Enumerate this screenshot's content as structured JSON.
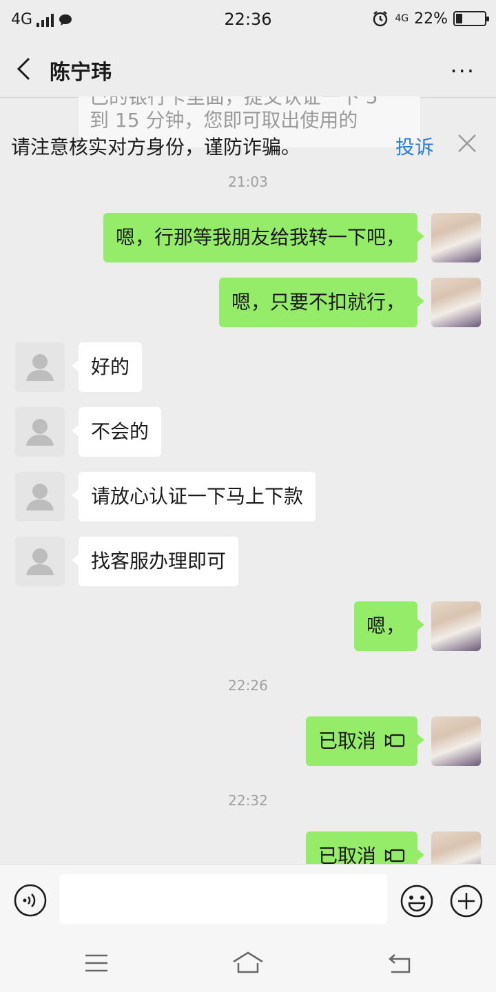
{
  "status_bar": {
    "network": "4G",
    "time": "22:36",
    "battery_network": "4G",
    "battery_percent": "22%",
    "battery_level": 0.22
  },
  "nav": {
    "title": "陈宁玮",
    "more": "···"
  },
  "overlay_message": {
    "line1": "已的银行卡里面，提交认证一下 5",
    "line2": "到 15 分钟，您即可取出使用的"
  },
  "warning": {
    "text": "请注意核实对方身份，谨防诈骗。",
    "report": "投诉"
  },
  "messages": [
    {
      "type": "time",
      "text": "21:03"
    },
    {
      "type": "me",
      "text": "嗯，行那等我朋友给我转一下吧，"
    },
    {
      "type": "me",
      "text": "嗯，只要不扣就行，"
    },
    {
      "type": "other",
      "text": "好的"
    },
    {
      "type": "other",
      "text": "不会的"
    },
    {
      "type": "other",
      "text": "请放心认证一下马上下款"
    },
    {
      "type": "other",
      "text": "找客服办理即可"
    },
    {
      "type": "me",
      "text": "嗯，"
    },
    {
      "type": "time",
      "text": "22:26"
    },
    {
      "type": "me_call",
      "text": "已取消"
    },
    {
      "type": "time",
      "text": "22:32"
    },
    {
      "type": "me_call",
      "text": "已取消"
    }
  ],
  "input": {
    "placeholder": ""
  }
}
